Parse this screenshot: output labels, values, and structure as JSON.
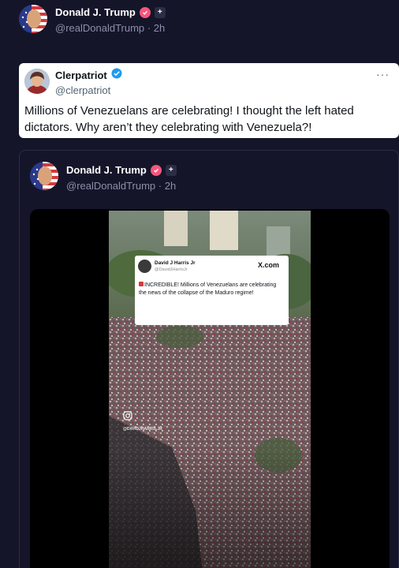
{
  "top_post": {
    "display_name": "Donald J. Trump",
    "handle": "@realDonaldTrump",
    "time": "2h",
    "separator": "·"
  },
  "quote": {
    "display_name": "Clerpatriot",
    "handle": "@clerpatriot",
    "text": "Millions of Venezuelans are celebrating! I thought the left hated dictators. Why aren’t they celebrating with Venezuela?!",
    "more": "···"
  },
  "inner_post": {
    "display_name": "Donald J. Trump",
    "handle": "@realDonaldTrump",
    "time": "2h",
    "separator": "·"
  },
  "embedded_tweet": {
    "display_name": "David J Harris Jr",
    "handle": "@DavidJHarrisJr",
    "brand": "X.com",
    "text": "INCREDIBLE! Millions of Venezuelans are celebrating the news of the collapse of the Maduro regime!"
  },
  "watermark": {
    "label": "@DAVIDJHARRIS.JR"
  },
  "colors": {
    "background": "#15152a",
    "badge_pink": "#f5567d",
    "verified_blue": "#1d9bf0"
  },
  "icons": {
    "badge": "verified-badge-icon",
    "plus": "plus-icon",
    "instagram": "instagram-icon"
  }
}
